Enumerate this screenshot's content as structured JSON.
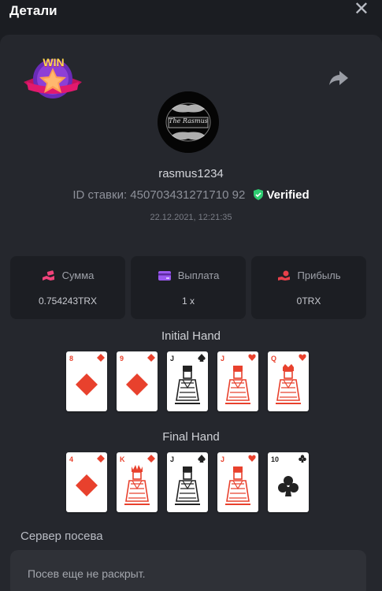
{
  "header": {
    "title": "Детали",
    "close_icon": "close-icon"
  },
  "badge": {
    "text": "WIN"
  },
  "player": {
    "username": "rasmus1234",
    "avatar_text": "The Rasmus",
    "bet_id_label": "ID ставки:",
    "bet_id": "450703431271710 92",
    "verified": "Verified",
    "timestamp": "22.12.2021, 12:21:35"
  },
  "stats": [
    {
      "label": "Сумма",
      "value": "0.754243TRX",
      "icon": "money-hand-icon",
      "color": "#f0437a"
    },
    {
      "label": "Выплата",
      "value": "1 x",
      "icon": "card-icon",
      "color": "#9b59f0"
    },
    {
      "label": "Прибыль",
      "value": "0TRX",
      "icon": "hand-coins-icon",
      "color": "#e8404a"
    }
  ],
  "initial_hand": {
    "label": "Initial Hand",
    "cards": [
      {
        "rank": "8",
        "suit": "diamond",
        "face": "diamond",
        "color": "#e8412d"
      },
      {
        "rank": "9",
        "suit": "diamond",
        "face": "diamond",
        "color": "#e8412d"
      },
      {
        "rank": "J",
        "suit": "spade",
        "face": "jack",
        "color": "#222222"
      },
      {
        "rank": "J",
        "suit": "heart",
        "face": "jack",
        "color": "#e8412d"
      },
      {
        "rank": "Q",
        "suit": "heart",
        "face": "queen",
        "color": "#e8412d"
      }
    ]
  },
  "final_hand": {
    "label": "Final Hand",
    "cards": [
      {
        "rank": "4",
        "suit": "diamond",
        "face": "diamond",
        "color": "#e8412d"
      },
      {
        "rank": "K",
        "suit": "diamond",
        "face": "king",
        "color": "#e8412d"
      },
      {
        "rank": "J",
        "suit": "spade",
        "face": "jack",
        "color": "#222222"
      },
      {
        "rank": "J",
        "suit": "heart",
        "face": "jack",
        "color": "#e8412d"
      },
      {
        "rank": "10",
        "suit": "club",
        "face": "club",
        "color": "#222222"
      }
    ]
  },
  "seed": {
    "label": "Сервер посева",
    "value": "Посев еще не раскрыт."
  },
  "colors": {
    "accent_green": "#2ecc71",
    "panel": "#25272d",
    "background": "#1b1d22"
  }
}
